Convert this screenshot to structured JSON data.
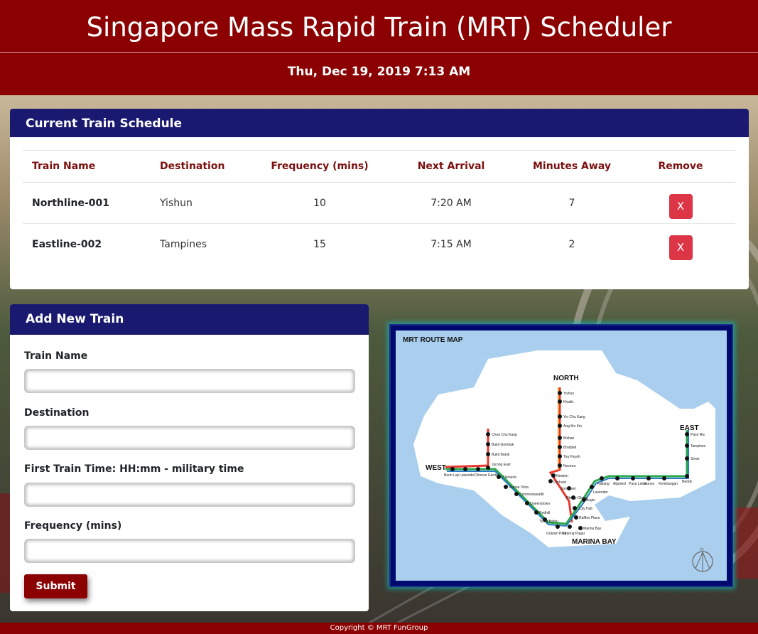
{
  "header": {
    "title": "Singapore Mass Rapid Train (MRT) Scheduler",
    "datetime": "Thu, Dec 19, 2019 7:13 AM"
  },
  "schedule": {
    "title": "Current Train Schedule",
    "columns": [
      "Train Name",
      "Destination",
      "Frequency (mins)",
      "Next Arrival",
      "Minutes Away",
      "Remove"
    ],
    "rows": [
      {
        "name": "Northline-001",
        "destination": "Yishun",
        "frequency": "10",
        "next_arrival": "7:20 AM",
        "minutes_away": "7",
        "remove": "X"
      },
      {
        "name": "Eastline-002",
        "destination": "Tampines",
        "frequency": "15",
        "next_arrival": "7:15 AM",
        "minutes_away": "2",
        "remove": "X"
      }
    ]
  },
  "add_train": {
    "title": "Add New Train",
    "train_name_label": "Train Name",
    "destination_label": "Destination",
    "first_time_label": "First Train Time: HH:mm - military time",
    "frequency_label": "Frequency (mins)",
    "submit_label": "Submit"
  },
  "map": {
    "title": "MRT ROUTE MAP",
    "north": "NORTH",
    "east": "EAST",
    "west": "WEST",
    "marina_bay": "MARINA BAY",
    "compass": "N",
    "stations": {
      "yishun": "Yishun",
      "khatib": "Khatib",
      "yio_chu_kang": "Yio Chu Kang",
      "ang_mo_kio": "Ang Mo Kio",
      "bishan": "Bishan",
      "braddell": "Braddell",
      "toa_payoh": "Toa Payoh",
      "novena": "Novena",
      "newton": "Newton",
      "orchard": "Orchard",
      "somerset": "Somerset",
      "dhoby_ghaut": "Dhoby Ghaut",
      "city_hall": "City Hall",
      "raffles_place": "Raffles Place",
      "marina_bay_stn": "Marina Bay",
      "choa_chu_kang": "Choa Chu Kang",
      "bukit_gombak": "Bukit Gombak",
      "bukit_batok": "Bukit Batok",
      "jurong_east": "Jurong East",
      "boon_lay": "Boon Lay",
      "lakeside": "Lakeside",
      "chinese_garden": "Chinese Garden",
      "clementi": "Clementi",
      "buona_vista": "Buona Vista",
      "commonwealth": "Commonwealth",
      "queenstown": "Queenstown",
      "redhill": "Redhill",
      "tiong_bahru": "Tiong Bahru",
      "outram_park": "Outram Park",
      "tanjong_pagar": "Tanjong Pagar",
      "bugis": "Bugis",
      "lavender": "Lavender",
      "kallang": "Kallang",
      "aljunied": "Aljunied",
      "paya_lebar": "Paya Lebar",
      "eunos": "Eunos",
      "kembangan": "Kembangan",
      "bedok": "Bedok",
      "simei": "Simei",
      "tampines": "Tampines",
      "pasir_ris": "Pasir Ris"
    }
  },
  "footer": {
    "copyright": "Copyright © MRT FunGroup"
  },
  "colors": {
    "header_red": "#8b0000",
    "card_header_navy": "#191970",
    "remove_red": "#dc3545",
    "column_header": "#7b0f0f"
  }
}
